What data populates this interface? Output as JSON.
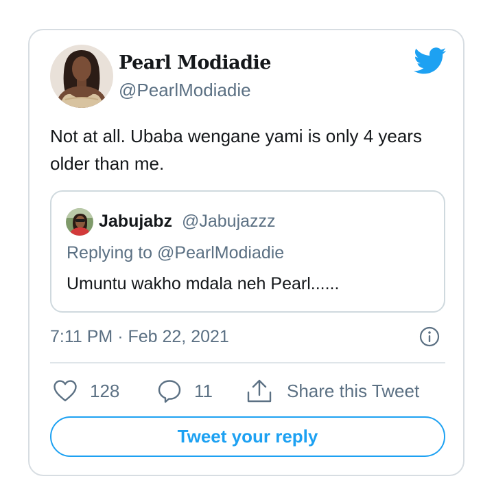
{
  "tweet": {
    "display_name": "Pearl Modiadie",
    "handle": "@PearlModiadie",
    "text": "Not at all. Ubaba wengane yami is only 4 years older than me.",
    "timestamp": "7:11 PM · Feb 22, 2021",
    "brand_color": "#1da1f2"
  },
  "quoted_tweet": {
    "display_name": "Jabujabz",
    "handle": "@Jabujazzz",
    "replying_to": "Replying to @PearlModiadie",
    "text": "Umuntu wakho mdala neh Pearl......"
  },
  "actions": {
    "likes": "128",
    "replies": "11",
    "share_label": "Share this Tweet"
  },
  "reply_button": {
    "label": "Tweet your reply"
  },
  "icons": {
    "logo": "twitter-bird-icon",
    "info": "info-icon",
    "like": "heart-icon",
    "reply": "speech-bubble-icon",
    "share": "share-upload-icon"
  }
}
